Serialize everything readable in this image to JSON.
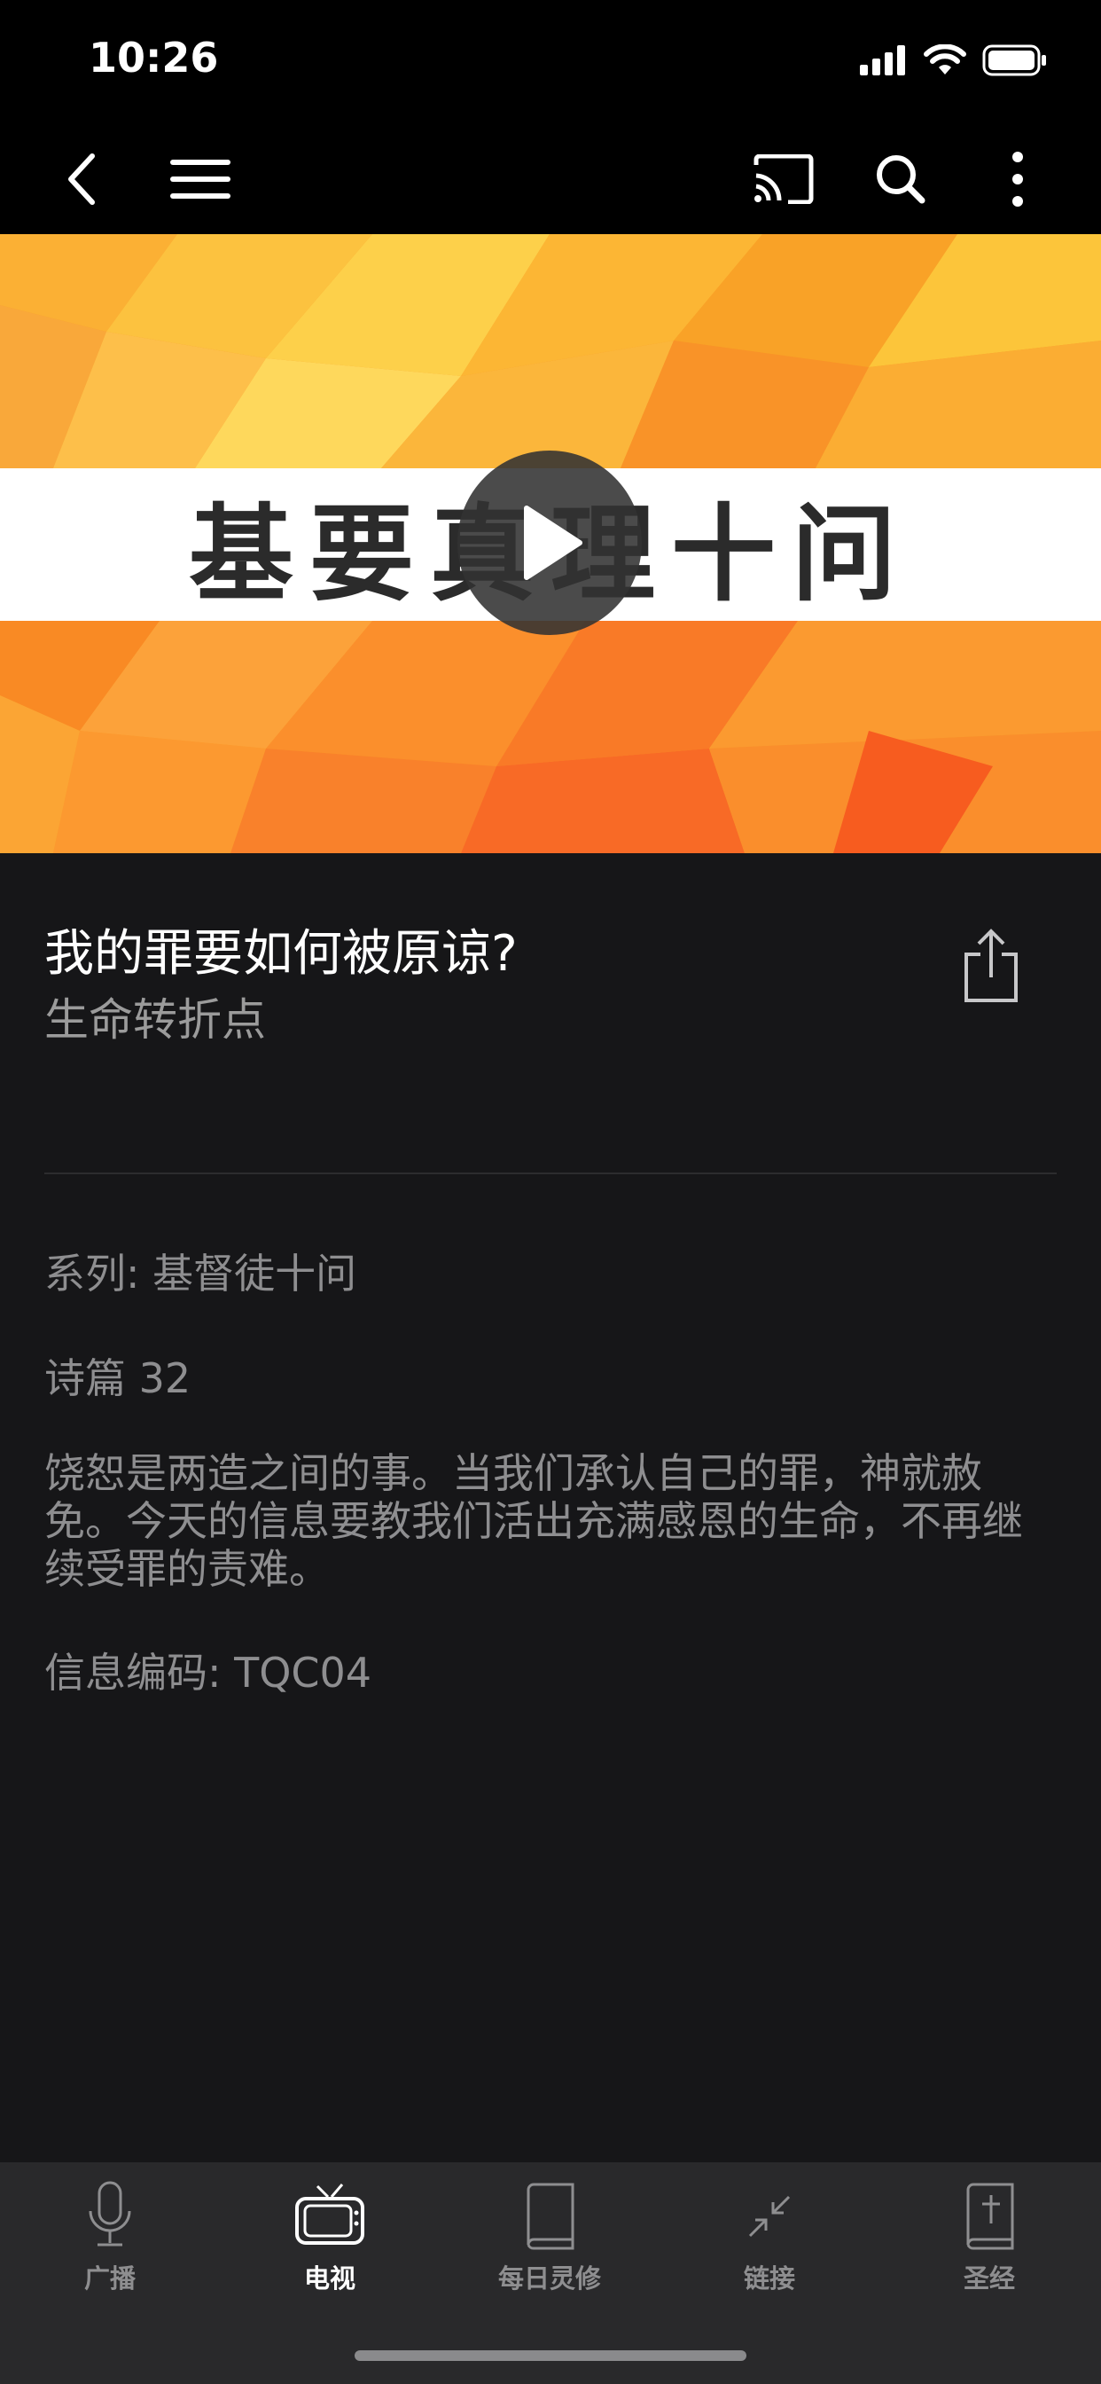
{
  "status": {
    "time": "10:26"
  },
  "hero": {
    "title": "基要真理十问"
  },
  "message": {
    "title": "我的罪要如何被原谅?",
    "program": "生命转折点",
    "series": "系列: 基督徒十问",
    "scripture": "诗篇 32",
    "description": "饶恕是两造之间的事。当我们承认自己的罪，神就赦免。今天的信息要教我们活出充满感恩的生命，不再继续受罪的责难。",
    "code": "信息编码: TQC04"
  },
  "tabs": [
    {
      "label": "广播",
      "icon": "microphone-icon",
      "active": false
    },
    {
      "label": "电视",
      "icon": "tv-icon",
      "active": true
    },
    {
      "label": "每日灵修",
      "icon": "book-icon",
      "active": false
    },
    {
      "label": "链接",
      "icon": "link-icon",
      "active": false
    },
    {
      "label": "圣经",
      "icon": "bible-icon",
      "active": false
    }
  ],
  "colors": {
    "background": "#161618",
    "tabbar": "#29292b",
    "hero_orange": "#f99a25",
    "muted_text": "#8e8e90"
  }
}
